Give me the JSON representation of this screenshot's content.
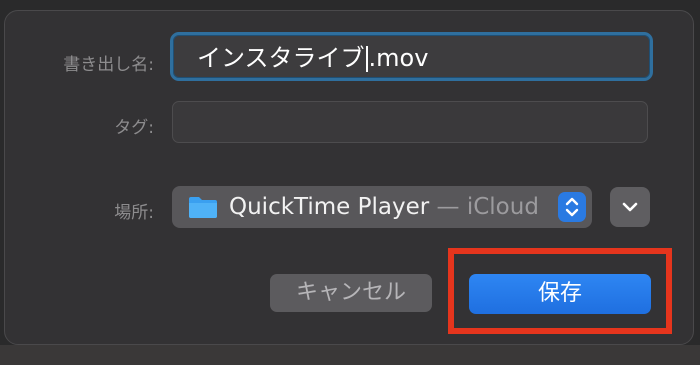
{
  "dialog": {
    "filename_label": "書き出し名:",
    "filename_before_caret": "インスタライブ",
    "filename_after_caret": ".mov",
    "tags_label": "タグ:",
    "tags_value": "",
    "where_label": "場所:",
    "where_folder": "QuickTime Player",
    "where_location": " — iCloud",
    "cancel_label": "キャンセル",
    "save_label": "保存"
  },
  "colors": {
    "accent": "#2a7ae2",
    "highlight": "#e5351d",
    "field_focus": "#2f6f9e"
  },
  "icons": {
    "folder": "folder-icon",
    "stepper": "up-down-chevron-icon",
    "disclosure": "chevron-down-icon"
  }
}
